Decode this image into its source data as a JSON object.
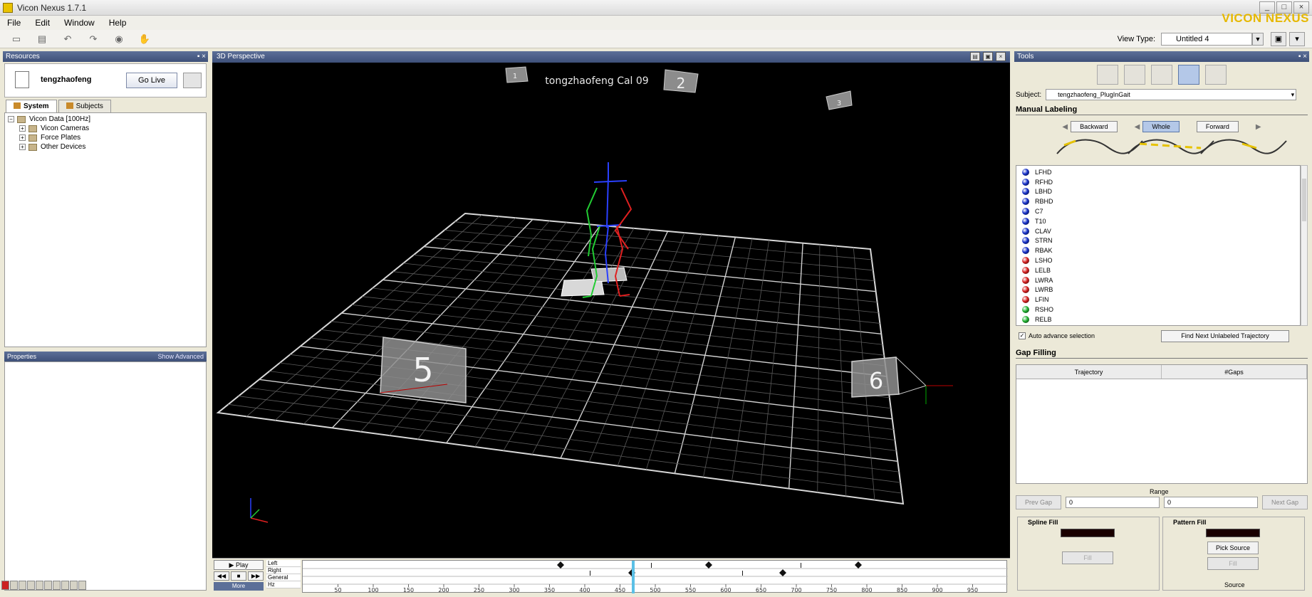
{
  "window": {
    "title": "Vicon Nexus 1.7.1",
    "brand": "VICON NEXUS",
    "controls": [
      "_",
      "□",
      "×"
    ]
  },
  "menu": [
    "File",
    "Edit",
    "Window",
    "Help"
  ],
  "toolbar": {
    "icons": [
      "open-icon",
      "save-icon",
      "undo-icon",
      "redo-icon",
      "capture-icon",
      "hand-icon"
    ],
    "view_type_label": "View Type:",
    "view_type_value": "Untitled 4"
  },
  "left_panel": {
    "header": "Resources",
    "subject_name": "tengzhaofeng",
    "go_live": "Go Live",
    "tabs": [
      "System",
      "Subjects"
    ],
    "tree": [
      {
        "label": "Vicon Data [100Hz]",
        "depth": 0
      },
      {
        "label": "Vicon Cameras",
        "depth": 1
      },
      {
        "label": "Force Plates",
        "depth": 1
      },
      {
        "label": "Other Devices",
        "depth": 1
      }
    ],
    "properties_header": "Properties",
    "show_advanced": "Show Advanced"
  },
  "viewport": {
    "header": "3D Perspective",
    "overlay_title": "tongzhaofeng Cal 09",
    "camera_labels": [
      "1",
      "2",
      "3",
      "5",
      "6"
    ]
  },
  "timeline": {
    "play_label": "Play",
    "more_label": "More",
    "tracks": [
      "Left",
      "Right",
      "General",
      "Hz"
    ],
    "ticks": [
      "50",
      "100",
      "150",
      "200",
      "250",
      "300",
      "350",
      "400",
      "450",
      "500",
      "550",
      "600",
      "650",
      "700",
      "750",
      "800",
      "850",
      "900",
      "950"
    ]
  },
  "right_panel": {
    "header": "Tools",
    "subject_label": "Subject:",
    "subject_value": "tengzhaofeng_PlugInGait",
    "manual_labeling": "Manual Labeling",
    "buttons": {
      "backward": "Backward",
      "whole": "Whole",
      "forward": "Forward"
    },
    "markers": [
      {
        "name": "LFHD",
        "color": "#1530c8"
      },
      {
        "name": "RFHD",
        "color": "#1530c8"
      },
      {
        "name": "LBHD",
        "color": "#1530c8"
      },
      {
        "name": "RBHD",
        "color": "#1530c8"
      },
      {
        "name": "C7",
        "color": "#1530c8"
      },
      {
        "name": "T10",
        "color": "#1530c8"
      },
      {
        "name": "CLAV",
        "color": "#1530c8"
      },
      {
        "name": "STRN",
        "color": "#1530c8"
      },
      {
        "name": "RBAK",
        "color": "#1530c8"
      },
      {
        "name": "LSHO",
        "color": "#d42020"
      },
      {
        "name": "LELB",
        "color": "#d42020"
      },
      {
        "name": "LWRA",
        "color": "#d42020"
      },
      {
        "name": "LWRB",
        "color": "#d42020"
      },
      {
        "name": "LFIN",
        "color": "#d42020"
      },
      {
        "name": "RSHO",
        "color": "#20b030"
      },
      {
        "name": "RELB",
        "color": "#20b030"
      }
    ],
    "auto_advance": "Auto advance selection",
    "find_next": "Find Next Unlabeled Trajectory",
    "gap_filling": "Gap Filling",
    "gap_columns": [
      "Trajectory",
      "#Gaps"
    ],
    "range_label": "Range",
    "prev_gap": "Prev Gap",
    "next_gap": "Next Gap",
    "range_start": "0",
    "range_end": "0",
    "spline_fill": "Spline Fill",
    "pattern_fill": "Pattern Fill",
    "fill_btn": "Fill",
    "pick_source": "Pick Source",
    "apply_btn": "Fill",
    "source_caption": "Source"
  }
}
